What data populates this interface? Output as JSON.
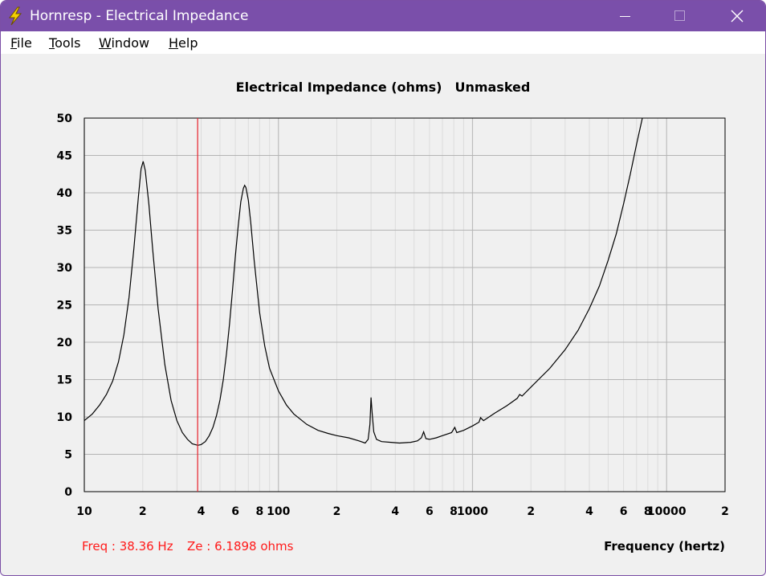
{
  "window": {
    "title": "Hornresp - Electrical Impedance",
    "icon": "lightning-bolt-icon",
    "controls": [
      "minimize-icon",
      "maximize-icon",
      "close-icon"
    ]
  },
  "menu": {
    "items": [
      {
        "accel": "F",
        "rest": "ile"
      },
      {
        "accel": "T",
        "rest": "ools"
      },
      {
        "accel": "W",
        "rest": "indow"
      },
      {
        "accel": "H",
        "rest": "elp"
      }
    ]
  },
  "chart_title": {
    "main": "Electrical Impedance (ohms)",
    "mode": "Unmasked"
  },
  "readout": {
    "freq": "Freq : 38.36 Hz",
    "ze": "Ze : 6.1898 ohms"
  },
  "colors": {
    "curve": "#000000",
    "cursor": "#e8202a",
    "readout": "#ff1a1a",
    "title_bar": "#7a4faa"
  },
  "chart_data": {
    "type": "line",
    "xlabel": "Frequency (hertz)",
    "ylabel": "",
    "x_scale": "log",
    "xlim": [
      10,
      20000
    ],
    "ylim": [
      0,
      50
    ],
    "y_ticks": [
      "0",
      "5",
      "10",
      "15",
      "20",
      "25",
      "30",
      "35",
      "40",
      "45",
      "50"
    ],
    "x_tick_labels": [
      {
        "value": 10,
        "label": "10"
      },
      {
        "value": 20,
        "label": "2"
      },
      {
        "value": 40,
        "label": "4"
      },
      {
        "value": 60,
        "label": "6"
      },
      {
        "value": 80,
        "label": "8"
      },
      {
        "value": 100,
        "label": "100"
      },
      {
        "value": 200,
        "label": "2"
      },
      {
        "value": 400,
        "label": "4"
      },
      {
        "value": 600,
        "label": "6"
      },
      {
        "value": 800,
        "label": "8"
      },
      {
        "value": 1000,
        "label": "1000"
      },
      {
        "value": 2000,
        "label": "2"
      },
      {
        "value": 4000,
        "label": "4"
      },
      {
        "value": 6000,
        "label": "6"
      },
      {
        "value": 8000,
        "label": "8"
      },
      {
        "value": 10000,
        "label": "10000"
      },
      {
        "value": 20000,
        "label": "2"
      }
    ],
    "grid": true,
    "cursor_x": 38.36,
    "series": [
      {
        "values": [
          [
            10,
            9.5
          ],
          [
            11,
            10.4
          ],
          [
            12,
            11.6
          ],
          [
            13,
            13.0
          ],
          [
            14,
            14.8
          ],
          [
            15,
            17.4
          ],
          [
            16,
            21.0
          ],
          [
            17,
            26.0
          ],
          [
            18,
            32.5
          ],
          [
            19,
            39.5
          ],
          [
            19.6,
            43.2
          ],
          [
            20.1,
            44.2
          ],
          [
            20.6,
            43.0
          ],
          [
            21.5,
            38.5
          ],
          [
            22.5,
            32.5
          ],
          [
            24,
            24.5
          ],
          [
            26,
            17.0
          ],
          [
            28,
            12.2
          ],
          [
            30,
            9.5
          ],
          [
            32,
            7.9
          ],
          [
            34,
            7.0
          ],
          [
            36,
            6.4
          ],
          [
            38.4,
            6.2
          ],
          [
            40,
            6.3
          ],
          [
            42,
            6.7
          ],
          [
            44,
            7.5
          ],
          [
            46,
            8.6
          ],
          [
            48,
            10.2
          ],
          [
            50,
            12.3
          ],
          [
            52,
            15.0
          ],
          [
            54,
            18.5
          ],
          [
            56,
            22.5
          ],
          [
            58,
            27.0
          ],
          [
            60,
            31.5
          ],
          [
            62,
            35.5
          ],
          [
            64,
            38.8
          ],
          [
            66,
            40.6
          ],
          [
            67,
            41.0
          ],
          [
            68,
            40.7
          ],
          [
            70,
            39.0
          ],
          [
            72,
            36.0
          ],
          [
            75,
            31.0
          ],
          [
            80,
            24.0
          ],
          [
            85,
            19.5
          ],
          [
            90,
            16.5
          ],
          [
            100,
            13.5
          ],
          [
            110,
            11.6
          ],
          [
            120,
            10.4
          ],
          [
            140,
            9.0
          ],
          [
            160,
            8.2
          ],
          [
            180,
            7.8
          ],
          [
            200,
            7.5
          ],
          [
            230,
            7.2
          ],
          [
            260,
            6.8
          ],
          [
            280,
            6.5
          ],
          [
            290,
            7.0
          ],
          [
            296,
            9.0
          ],
          [
            300,
            12.6
          ],
          [
            304,
            10.5
          ],
          [
            310,
            8.0
          ],
          [
            320,
            7.0
          ],
          [
            340,
            6.7
          ],
          [
            380,
            6.6
          ],
          [
            420,
            6.5
          ],
          [
            480,
            6.6
          ],
          [
            520,
            6.8
          ],
          [
            545,
            7.2
          ],
          [
            560,
            8.0
          ],
          [
            575,
            7.1
          ],
          [
            600,
            7.0
          ],
          [
            650,
            7.2
          ],
          [
            700,
            7.5
          ],
          [
            780,
            7.9
          ],
          [
            810,
            8.6
          ],
          [
            830,
            7.9
          ],
          [
            900,
            8.2
          ],
          [
            1000,
            8.8
          ],
          [
            1080,
            9.3
          ],
          [
            1100,
            9.9
          ],
          [
            1140,
            9.5
          ],
          [
            1300,
            10.5
          ],
          [
            1500,
            11.5
          ],
          [
            1700,
            12.5
          ],
          [
            1750,
            13.0
          ],
          [
            1800,
            12.8
          ],
          [
            2000,
            14.0
          ],
          [
            2500,
            16.5
          ],
          [
            3000,
            19.0
          ],
          [
            3500,
            21.6
          ],
          [
            4000,
            24.5
          ],
          [
            4500,
            27.5
          ],
          [
            5000,
            31.0
          ],
          [
            5500,
            34.5
          ],
          [
            6000,
            38.5
          ],
          [
            6500,
            42.5
          ],
          [
            7000,
            46.5
          ],
          [
            7500,
            50.0
          ]
        ]
      }
    ]
  }
}
